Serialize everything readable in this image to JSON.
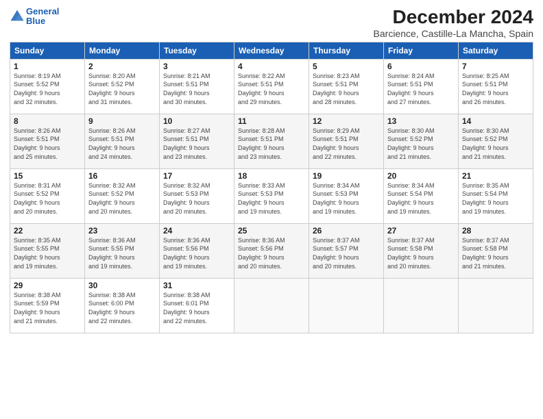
{
  "logo": {
    "line1": "General",
    "line2": "Blue"
  },
  "title": "December 2024",
  "subtitle": "Barcience, Castille-La Mancha, Spain",
  "headers": [
    "Sunday",
    "Monday",
    "Tuesday",
    "Wednesday",
    "Thursday",
    "Friday",
    "Saturday"
  ],
  "weeks": [
    [
      {
        "day": "1",
        "info": "Sunrise: 8:19 AM\nSunset: 5:52 PM\nDaylight: 9 hours\nand 32 minutes."
      },
      {
        "day": "2",
        "info": "Sunrise: 8:20 AM\nSunset: 5:52 PM\nDaylight: 9 hours\nand 31 minutes."
      },
      {
        "day": "3",
        "info": "Sunrise: 8:21 AM\nSunset: 5:51 PM\nDaylight: 9 hours\nand 30 minutes."
      },
      {
        "day": "4",
        "info": "Sunrise: 8:22 AM\nSunset: 5:51 PM\nDaylight: 9 hours\nand 29 minutes."
      },
      {
        "day": "5",
        "info": "Sunrise: 8:23 AM\nSunset: 5:51 PM\nDaylight: 9 hours\nand 28 minutes."
      },
      {
        "day": "6",
        "info": "Sunrise: 8:24 AM\nSunset: 5:51 PM\nDaylight: 9 hours\nand 27 minutes."
      },
      {
        "day": "7",
        "info": "Sunrise: 8:25 AM\nSunset: 5:51 PM\nDaylight: 9 hours\nand 26 minutes."
      }
    ],
    [
      {
        "day": "8",
        "info": "Sunrise: 8:26 AM\nSunset: 5:51 PM\nDaylight: 9 hours\nand 25 minutes."
      },
      {
        "day": "9",
        "info": "Sunrise: 8:26 AM\nSunset: 5:51 PM\nDaylight: 9 hours\nand 24 minutes."
      },
      {
        "day": "10",
        "info": "Sunrise: 8:27 AM\nSunset: 5:51 PM\nDaylight: 9 hours\nand 23 minutes."
      },
      {
        "day": "11",
        "info": "Sunrise: 8:28 AM\nSunset: 5:51 PM\nDaylight: 9 hours\nand 23 minutes."
      },
      {
        "day": "12",
        "info": "Sunrise: 8:29 AM\nSunset: 5:51 PM\nDaylight: 9 hours\nand 22 minutes."
      },
      {
        "day": "13",
        "info": "Sunrise: 8:30 AM\nSunset: 5:52 PM\nDaylight: 9 hours\nand 21 minutes."
      },
      {
        "day": "14",
        "info": "Sunrise: 8:30 AM\nSunset: 5:52 PM\nDaylight: 9 hours\nand 21 minutes."
      }
    ],
    [
      {
        "day": "15",
        "info": "Sunrise: 8:31 AM\nSunset: 5:52 PM\nDaylight: 9 hours\nand 20 minutes."
      },
      {
        "day": "16",
        "info": "Sunrise: 8:32 AM\nSunset: 5:52 PM\nDaylight: 9 hours\nand 20 minutes."
      },
      {
        "day": "17",
        "info": "Sunrise: 8:32 AM\nSunset: 5:53 PM\nDaylight: 9 hours\nand 20 minutes."
      },
      {
        "day": "18",
        "info": "Sunrise: 8:33 AM\nSunset: 5:53 PM\nDaylight: 9 hours\nand 19 minutes."
      },
      {
        "day": "19",
        "info": "Sunrise: 8:34 AM\nSunset: 5:53 PM\nDaylight: 9 hours\nand 19 minutes."
      },
      {
        "day": "20",
        "info": "Sunrise: 8:34 AM\nSunset: 5:54 PM\nDaylight: 9 hours\nand 19 minutes."
      },
      {
        "day": "21",
        "info": "Sunrise: 8:35 AM\nSunset: 5:54 PM\nDaylight: 9 hours\nand 19 minutes."
      }
    ],
    [
      {
        "day": "22",
        "info": "Sunrise: 8:35 AM\nSunset: 5:55 PM\nDaylight: 9 hours\nand 19 minutes."
      },
      {
        "day": "23",
        "info": "Sunrise: 8:36 AM\nSunset: 5:55 PM\nDaylight: 9 hours\nand 19 minutes."
      },
      {
        "day": "24",
        "info": "Sunrise: 8:36 AM\nSunset: 5:56 PM\nDaylight: 9 hours\nand 19 minutes."
      },
      {
        "day": "25",
        "info": "Sunrise: 8:36 AM\nSunset: 5:56 PM\nDaylight: 9 hours\nand 20 minutes."
      },
      {
        "day": "26",
        "info": "Sunrise: 8:37 AM\nSunset: 5:57 PM\nDaylight: 9 hours\nand 20 minutes."
      },
      {
        "day": "27",
        "info": "Sunrise: 8:37 AM\nSunset: 5:58 PM\nDaylight: 9 hours\nand 20 minutes."
      },
      {
        "day": "28",
        "info": "Sunrise: 8:37 AM\nSunset: 5:58 PM\nDaylight: 9 hours\nand 21 minutes."
      }
    ],
    [
      {
        "day": "29",
        "info": "Sunrise: 8:38 AM\nSunset: 5:59 PM\nDaylight: 9 hours\nand 21 minutes."
      },
      {
        "day": "30",
        "info": "Sunrise: 8:38 AM\nSunset: 6:00 PM\nDaylight: 9 hours\nand 22 minutes."
      },
      {
        "day": "31",
        "info": "Sunrise: 8:38 AM\nSunset: 6:01 PM\nDaylight: 9 hours\nand 22 minutes."
      },
      {
        "day": "",
        "info": ""
      },
      {
        "day": "",
        "info": ""
      },
      {
        "day": "",
        "info": ""
      },
      {
        "day": "",
        "info": ""
      }
    ]
  ]
}
